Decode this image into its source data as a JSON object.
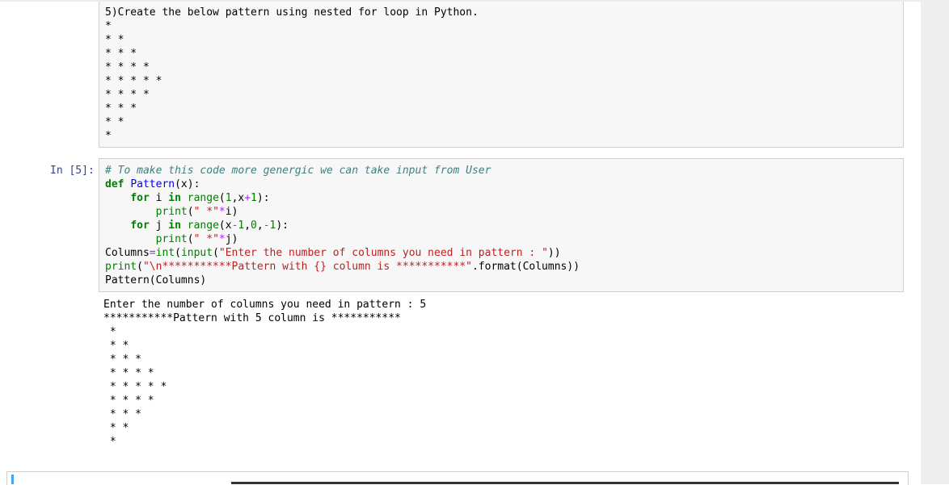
{
  "markdown_cell": {
    "lines": [
      "5)Create the below pattern using nested for loop in Python.",
      "*",
      "* *",
      "* * *",
      "* * * *",
      "* * * * *",
      "* * * *",
      "* * *",
      "* *",
      "*"
    ]
  },
  "code_cell": {
    "prompt": "In [5]:",
    "comment": "# To make this code more genergic we can take input from User",
    "def_kw": "def",
    "func_name": "Pattern",
    "def_params": "(x):",
    "indent1": "    ",
    "indent2": "        ",
    "for_kw": "for",
    "in_kw": "in",
    "var_i": " i ",
    "var_j": " j ",
    "range_fn": "range",
    "loop1_args_open": "(",
    "loop1_arg1": "1",
    "loop1_arg_sep": ",x",
    "loop1_plus": "+",
    "loop1_arg2": "1",
    "loop1_close": "):",
    "loop2_args_open": "(x",
    "loop2_minus1": "-",
    "loop2_arg1": "1",
    "loop2_sep1": ",",
    "loop2_arg2": "0",
    "loop2_sep2": ",",
    "loop2_minus2": "-",
    "loop2_arg3": "1",
    "loop2_close": "):",
    "print_fn": "print",
    "paren_open": "(",
    "star_str": "\" *\"",
    "mult_op": "*",
    "var_i_only": "i",
    "var_j_only": "j",
    "paren_close": ")",
    "columns_var": "Columns",
    "assign_op": "=",
    "int_fn": "int",
    "input_fn": "input",
    "input_prompt_str": "\"Enter the number of columns you need in pattern : \"",
    "input_close": "))",
    "print_open": "(",
    "header_str": "\"\\n***********Pattern with {} column is ***********\"",
    "format_call": ".format(Columns))",
    "call_line": "Pattern(Columns)"
  },
  "output": {
    "lines": [
      "Enter the number of columns you need in pattern : 5",
      "",
      "***********Pattern with 5 column is ***********",
      " *",
      " * *",
      " * * *",
      " * * * *",
      " * * * * *",
      " * * * *",
      " * * *",
      " * *",
      " *"
    ]
  }
}
